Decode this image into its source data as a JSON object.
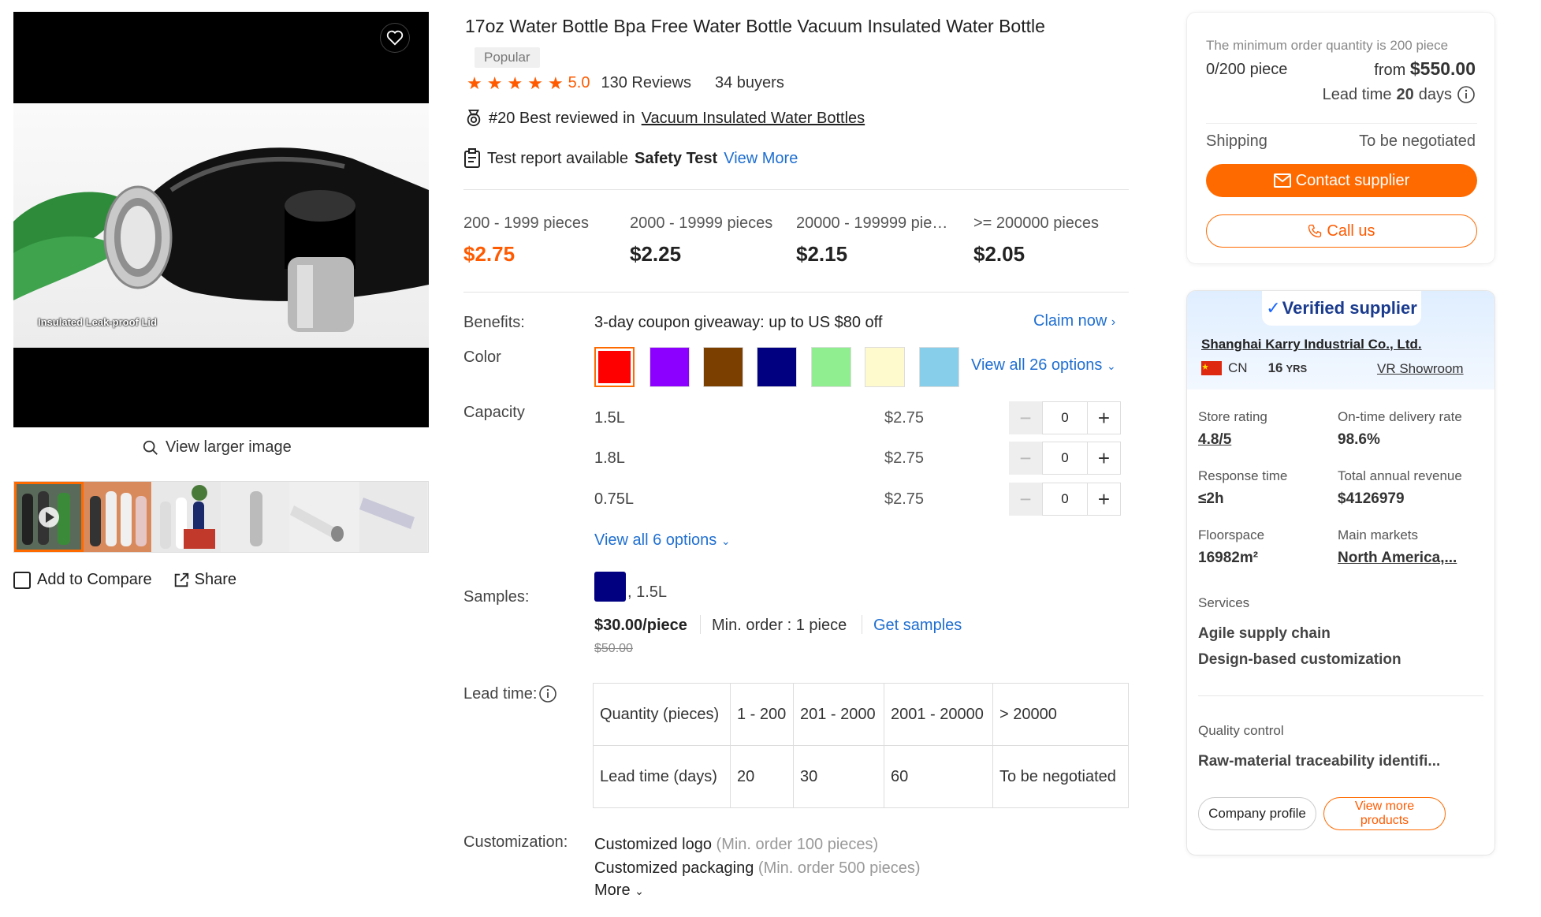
{
  "product": {
    "title": "17oz Water Bottle Bpa Free Water Bottle Vacuum Insulated Water Bottle",
    "badge": "Popular",
    "rating": "5.0",
    "reviews": "130 Reviews",
    "buyers": "34 buyers",
    "best_prefix": "#20 Best reviewed in",
    "best_category": "Vacuum Insulated Water Bottles",
    "test_prefix": "Test report available",
    "test_bold": "Safety Test",
    "test_link": "View More"
  },
  "gallery": {
    "image_caption": "Insulated Leak-proof Lid",
    "view_larger": "View larger image",
    "add_compare": "Add to Compare",
    "share": "Share"
  },
  "price_tiers": [
    {
      "range": "200 - 1999 pieces",
      "price": "$2.75"
    },
    {
      "range": "2000 - 19999 pieces",
      "price": "$2.25"
    },
    {
      "range": "20000 - 199999 pie…",
      "price": "$2.15"
    },
    {
      "range": ">= 200000 pieces",
      "price": "$2.05"
    }
  ],
  "benefits": {
    "label": "Benefits:",
    "text": "3-day coupon giveaway: up to US $80 off",
    "link": "Claim now"
  },
  "color": {
    "label": "Color",
    "swatches": [
      "#ff0000",
      "#8b00ff",
      "#7b3f00",
      "#000080",
      "#90ee90",
      "#fffacd",
      "#87ceeb"
    ],
    "view_all": "View all 26 options"
  },
  "capacity": {
    "label": "Capacity",
    "rows": [
      {
        "name": "1.5L",
        "price": "$2.75",
        "qty": "0"
      },
      {
        "name": "1.8L",
        "price": "$2.75",
        "qty": "0"
      },
      {
        "name": "0.75L",
        "price": "$2.75",
        "qty": "0"
      }
    ],
    "view_all": "View all 6 options"
  },
  "samples": {
    "label": "Samples:",
    "variant": ", 1.5L",
    "price": "$30.00/piece",
    "min_order": "Min. order : 1 piece",
    "link": "Get samples",
    "old_price": "$50.00"
  },
  "lead_time": {
    "label": "Lead time:",
    "row1": [
      "Quantity (pieces)",
      "1 - 200",
      "201 - 2000",
      "2001 - 20000",
      "> 20000"
    ],
    "row2": [
      "Lead time (days)",
      "20",
      "30",
      "60",
      "To be negotiated"
    ]
  },
  "customization": {
    "label": "Customization:",
    "logo": "Customized logo",
    "logo_note": "(Min. order 100 pieces)",
    "packaging": "Customized packaging",
    "packaging_note": "(Min. order 500 pieces)",
    "more": "More"
  },
  "order": {
    "min_note": "The minimum order quantity is 200 piece",
    "progress": "0/200 piece",
    "from": "from",
    "total": "$550.00",
    "lead_prefix": "Lead time",
    "lead_days": "20",
    "lead_suffix": "days",
    "shipping_label": "Shipping",
    "shipping_value": "To be negotiated",
    "contact": "Contact supplier",
    "call": "Call us"
  },
  "supplier": {
    "verified": "Verified supplier",
    "name": "Shanghai Karry Industrial Co., Ltd.",
    "country": "CN",
    "years": "16",
    "years_unit": "YRS",
    "vr": "VR Showroom",
    "store_rating_label": "Store rating",
    "store_rating": "4.8/5",
    "ontime_label": "On-time delivery rate",
    "ontime": "98.6%",
    "response_label": "Response time",
    "response": "≤2h",
    "revenue_label": "Total annual revenue",
    "revenue": "$4126979",
    "floor_label": "Floorspace",
    "floor": "16982m²",
    "markets_label": "Main markets",
    "markets": "North America,...",
    "services_label": "Services",
    "service1": "Agile supply chain",
    "service2": "Design-based customization",
    "qc_label": "Quality control",
    "qc": "Raw-material traceability identifi...",
    "profile_btn": "Company profile",
    "more_btn": "View more products"
  },
  "colors": {
    "accent": "#ff6a00",
    "link": "#1f6fd1"
  }
}
